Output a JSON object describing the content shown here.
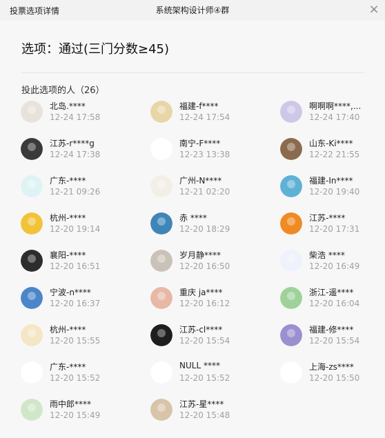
{
  "window": {
    "left_title": "投票选项详情",
    "center_title": "系统架构设计师④群",
    "close_glyph": "×"
  },
  "option": {
    "title": "选项：通过(三门分数≥45)"
  },
  "voters_label": "投此选项的人（26）",
  "voters": [
    {
      "name": "北岛.****",
      "time": "12-24 17:58",
      "color": "#e8e2da",
      "icon": "avatar-girl-icon"
    },
    {
      "name": "福建-f****",
      "time": "12-24 17:54",
      "color": "#e7d6a7",
      "icon": "avatar-figure-icon"
    },
    {
      "name": "啊啊啊****,...",
      "time": "12-24 17:40",
      "color": "#cfc7e8",
      "icon": "avatar-cartoon-icon"
    },
    {
      "name": "江苏-r****g",
      "time": "12-24 17:38",
      "color": "#3a3a3a",
      "icon": "avatar-glasses-icon"
    },
    {
      "name": "南宁-F****",
      "time": "12-23 13:38",
      "color": "#ffffff",
      "icon": "avatar-blank-icon"
    },
    {
      "name": "山东-Ki****",
      "time": "12-22 21:55",
      "color": "#8c6a4d",
      "icon": "avatar-dog-icon"
    },
    {
      "name": "广东-****",
      "time": "12-21 09:26",
      "color": "#dff3f5",
      "icon": "avatar-bear-icon"
    },
    {
      "name": "广州-N****",
      "time": "12-21 02:20",
      "color": "#f3efe6",
      "icon": "avatar-monkey-icon"
    },
    {
      "name": "福建-In****",
      "time": "12-20 19:40",
      "color": "#5fb1d6",
      "icon": "avatar-island-icon"
    },
    {
      "name": "杭州-****",
      "time": "12-20 19:14",
      "color": "#f2c33a",
      "icon": "avatar-ninja-icon"
    },
    {
      "name": "赤  ****",
      "time": "12-20 18:29",
      "color": "#3f86b8",
      "icon": "avatar-sea-icon"
    },
    {
      "name": "江苏-****",
      "time": "12-20 17:31",
      "color": "#f08a24",
      "icon": "avatar-fox-icon"
    },
    {
      "name": "襄阳-****",
      "time": "12-20 16:51",
      "color": "#2d2d2d",
      "icon": "avatar-dark-icon"
    },
    {
      "name": "岁月静****",
      "time": "12-20 16:50",
      "color": "#c9c2b8",
      "icon": "avatar-cat-icon"
    },
    {
      "name": "柴浩  ****",
      "time": "12-20 16:49",
      "color": "#eef2fb",
      "icon": "avatar-dragon-icon"
    },
    {
      "name": "宁波-n****",
      "time": "12-20 16:37",
      "color": "#4a86c9",
      "icon": "avatar-sky-icon"
    },
    {
      "name": "重庆 ja****",
      "time": "12-20 16:12",
      "color": "#e8b8a6",
      "icon": "avatar-sketch-icon"
    },
    {
      "name": "浙江-遥****",
      "time": "12-20 16:04",
      "color": "#9ed29a",
      "icon": "avatar-zoro-icon"
    },
    {
      "name": "杭州-****",
      "time": "12-20 15:55",
      "color": "#f5e6c6",
      "icon": "avatar-deer-icon"
    },
    {
      "name": "江苏-cl****",
      "time": "12-20 15:54",
      "color": "#1e1e1e",
      "icon": "avatar-shadow-icon"
    },
    {
      "name": "福建-修****",
      "time": "12-20 15:54",
      "color": "#9c8fcf",
      "icon": "avatar-anime-icon"
    },
    {
      "name": "广东-****",
      "time": "12-20 15:52",
      "color": "#ffffff",
      "icon": "avatar-bird-icon"
    },
    {
      "name": "NULL  ****",
      "time": "12-20 15:52",
      "color": "#ffffff",
      "icon": "avatar-panda-icon"
    },
    {
      "name": "上海-zs****",
      "time": "12-20 15:50",
      "color": "#ffffff",
      "icon": "avatar-calligraphy-icon"
    },
    {
      "name": "雨中郎****",
      "time": "12-20 15:49",
      "color": "#cfe7c8",
      "icon": "avatar-flower-icon"
    },
    {
      "name": "江苏-星****",
      "time": "12-20 15:48",
      "color": "#d8c4a8",
      "icon": "avatar-cake-icon"
    }
  ]
}
